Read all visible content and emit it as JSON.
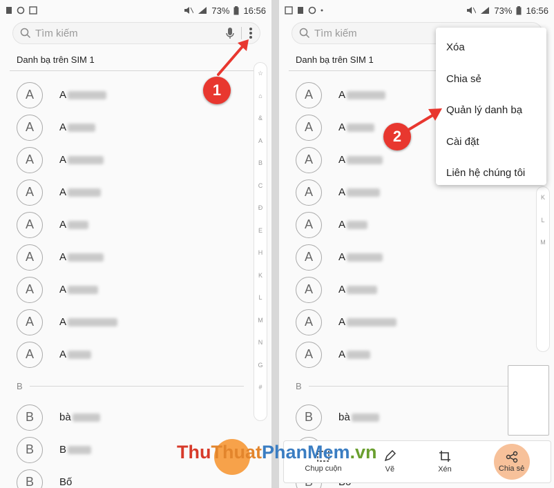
{
  "status": {
    "battery": "73%",
    "time": "16:56"
  },
  "search": {
    "placeholder": "Tìm kiếm"
  },
  "section_title": "Danh bạ trên SIM 1",
  "contacts_a": [
    {
      "initial": "A",
      "name": "A",
      "blur_width": 56
    },
    {
      "initial": "A",
      "name": "A",
      "blur_width": 40
    },
    {
      "initial": "A",
      "name": "A",
      "blur_width": 52
    },
    {
      "initial": "A",
      "name": "A",
      "blur_width": 48
    },
    {
      "initial": "A",
      "name": "A",
      "blur_width": 30
    },
    {
      "initial": "A",
      "name": "A",
      "blur_width": 52
    },
    {
      "initial": "A",
      "name": "A",
      "blur_width": 44
    },
    {
      "initial": "A",
      "name": "A",
      "blur_width": 72
    },
    {
      "initial": "A",
      "name": "A",
      "blur_width": 34
    }
  ],
  "section_b": "B",
  "contacts_b": [
    {
      "initial": "B",
      "name": "bà",
      "blur_width": 40
    },
    {
      "initial": "B",
      "name": "B",
      "blur_width": 34
    },
    {
      "initial": "B",
      "name": "Bố",
      "blur_width": 0
    }
  ],
  "index_letters": [
    "☆",
    "⌂",
    "&",
    "A",
    "B",
    "C",
    "Đ",
    "E",
    "H",
    "K",
    "L",
    "M",
    "N",
    "G",
    "#"
  ],
  "step1": "1",
  "step2": "2",
  "menu": [
    "Xóa",
    "Chia sẻ",
    "Quản lý danh bạ",
    "Cài đặt",
    "Liên hệ chúng tôi"
  ],
  "toolbar": {
    "capture": "Chụp cuộn",
    "draw": "Vẽ",
    "crop": "Xén",
    "share": "Chia sẻ"
  },
  "watermark": {
    "part1": "Thu",
    "part2": "Thuat",
    "part3": "PhanMem",
    "part4": ".vn"
  },
  "colors": {
    "badge": "#e8372f",
    "fab": "#f7a24a",
    "arrow": "#e8372f"
  }
}
